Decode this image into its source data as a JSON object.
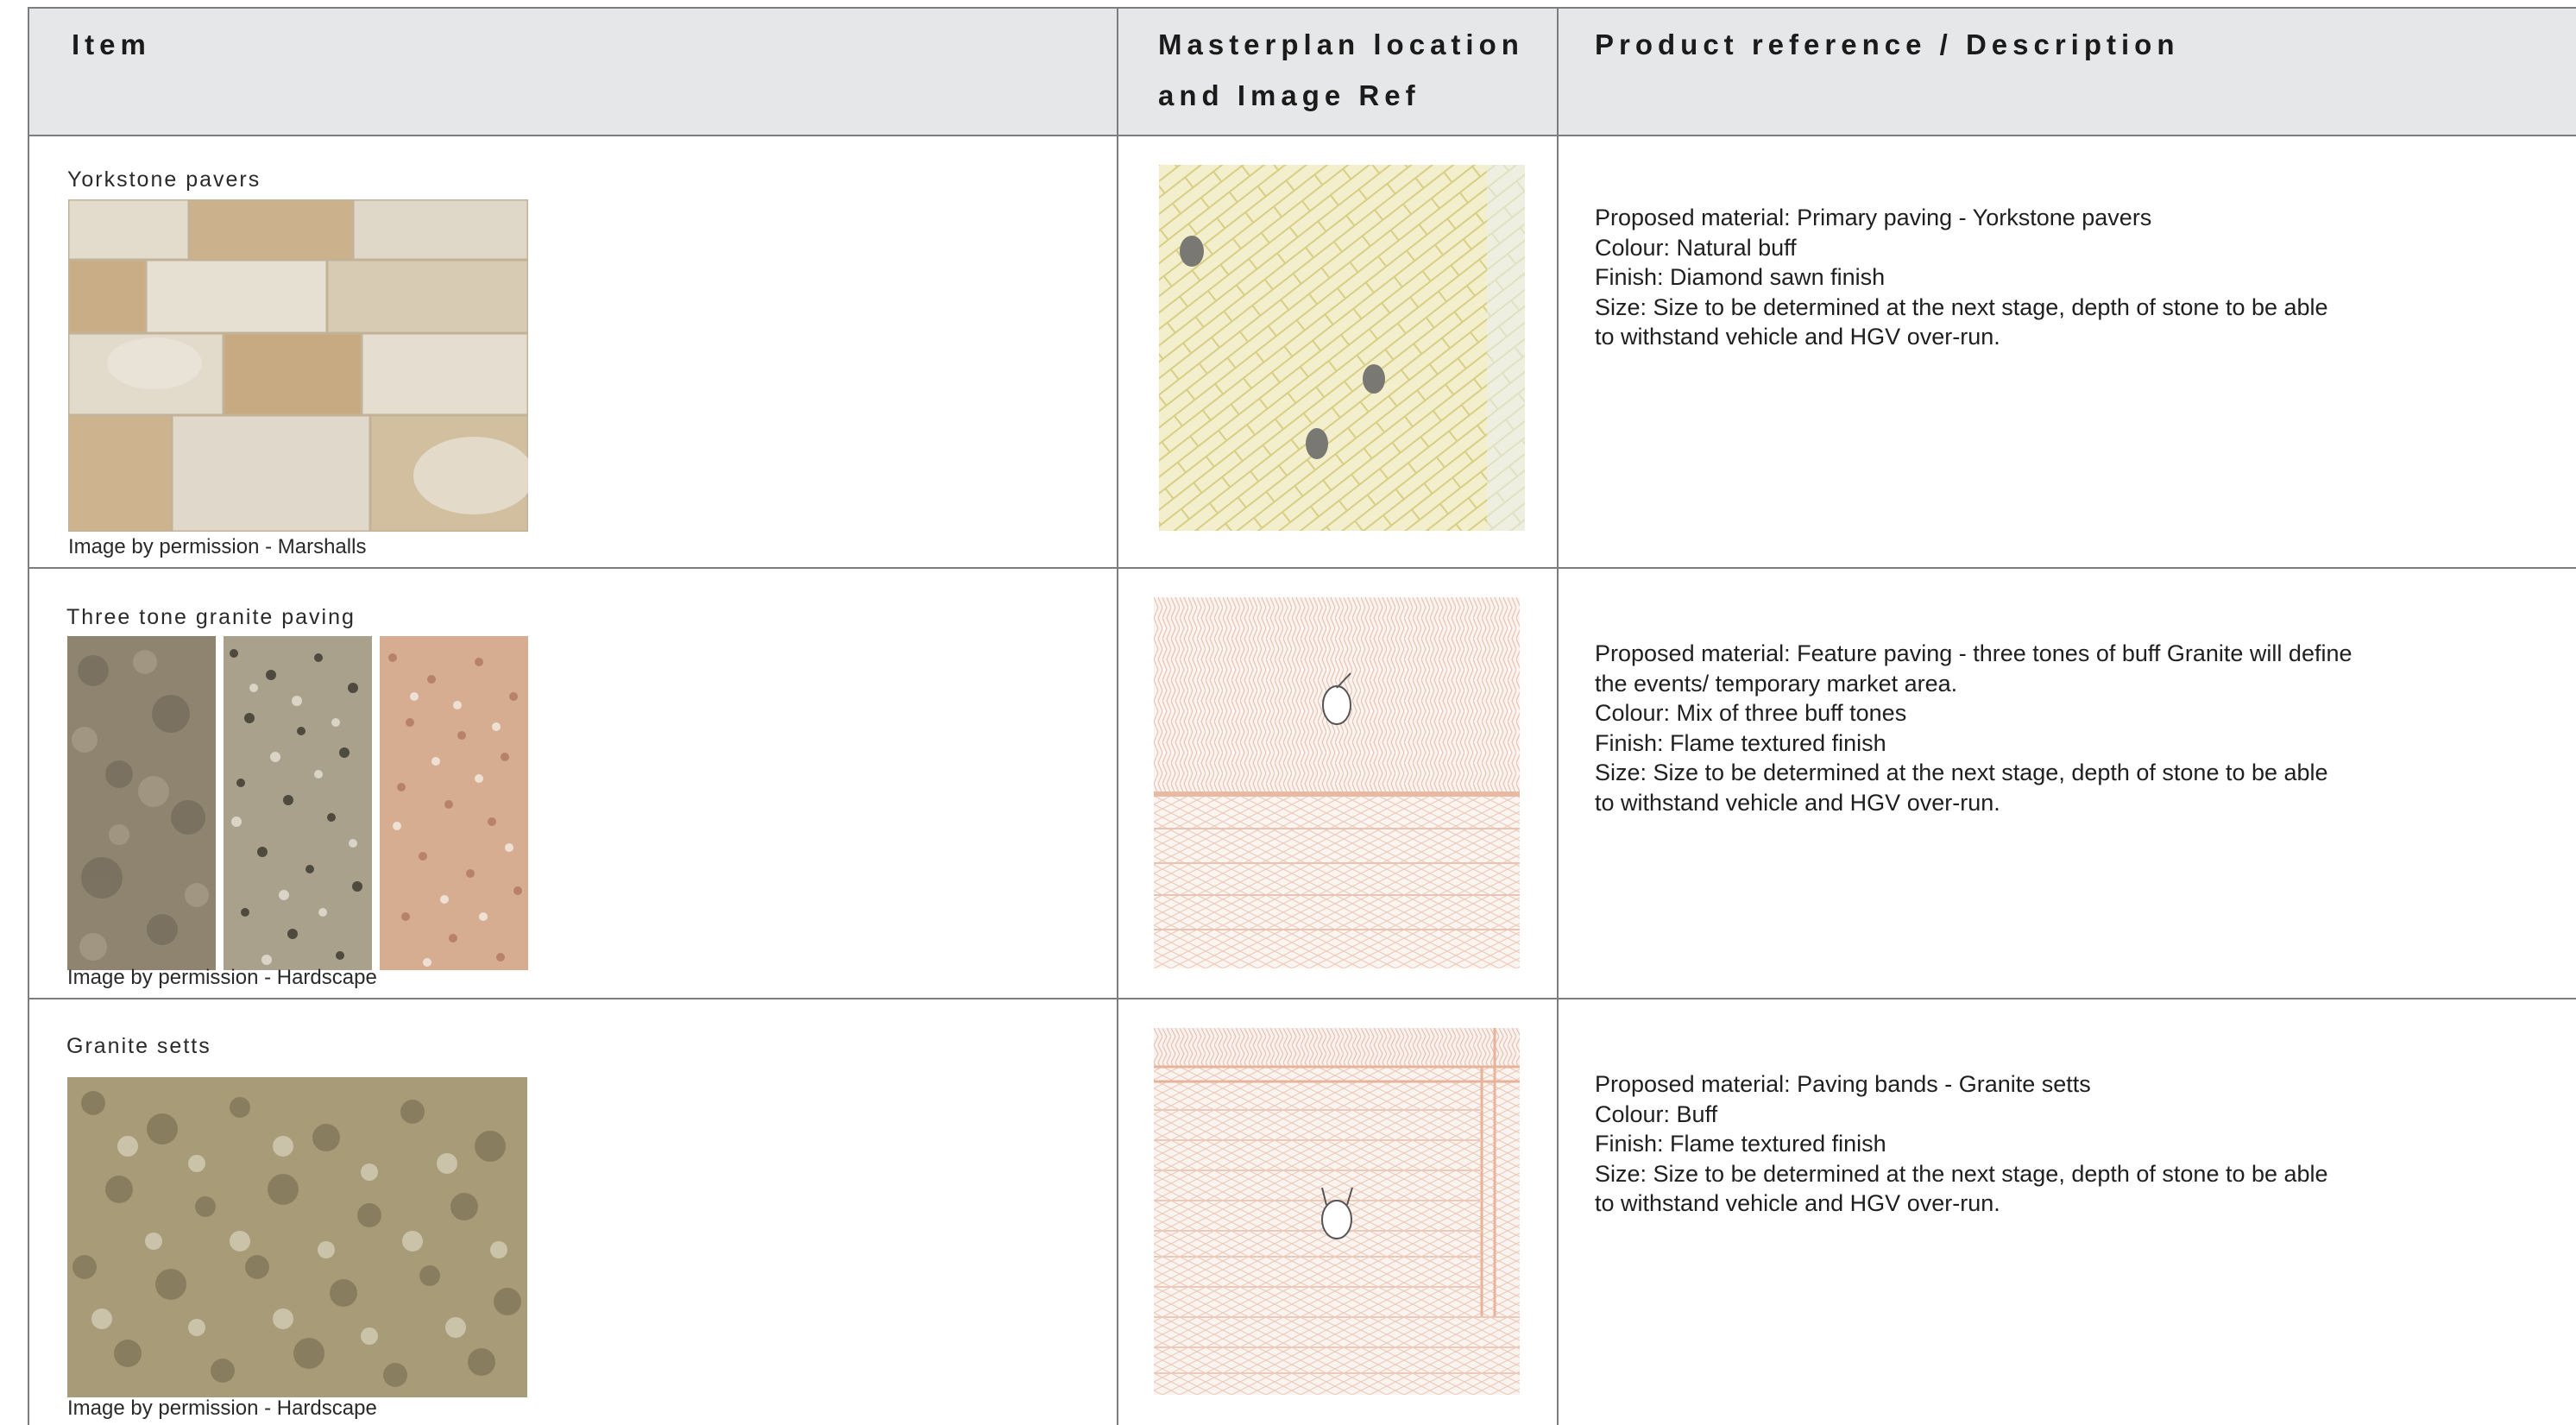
{
  "header": {
    "col_item": "Item",
    "col_location": "Masterplan location\nand Image Ref",
    "col_description": "Product reference / Description"
  },
  "rows": [
    {
      "item": "Yorkstone pavers",
      "credit": "Image by permission - Marshalls",
      "description": "Proposed material: Primary paving - Yorkstone pavers\nColour: Natural buff\nFinish: Diamond sawn finish\nSize: Size to be determined at the next stage, depth of stone to be able\nto withstand vehicle and HGV over-run."
    },
    {
      "item": "Three tone granite paving",
      "credit": "Image by permission - Hardscape",
      "description": "Proposed material: Feature paving - three tones of buff Granite will define\nthe events/ temporary market area.\nColour: Mix of three buff tones\nFinish: Flame textured finish\nSize: Size to be determined at the next stage, depth of stone to be able\nto withstand vehicle and HGV over-run."
    },
    {
      "item": "Granite setts",
      "credit": "Image by permission - Hardscape",
      "description": "Proposed material: Paving bands - Granite setts\nColour: Buff\nFinish: Flame textured finish\nSize: Size to be determined at the next stage, depth of stone to be able\nto withstand vehicle and HGV over-run."
    }
  ],
  "colors": {
    "header_bg": "#e6e7e9",
    "grid_line": "#7d7d7d",
    "yorkstone": "#d9ccb6",
    "plan_yellow": "#f1ecc4",
    "plan_pink": "#f5ddd0"
  }
}
